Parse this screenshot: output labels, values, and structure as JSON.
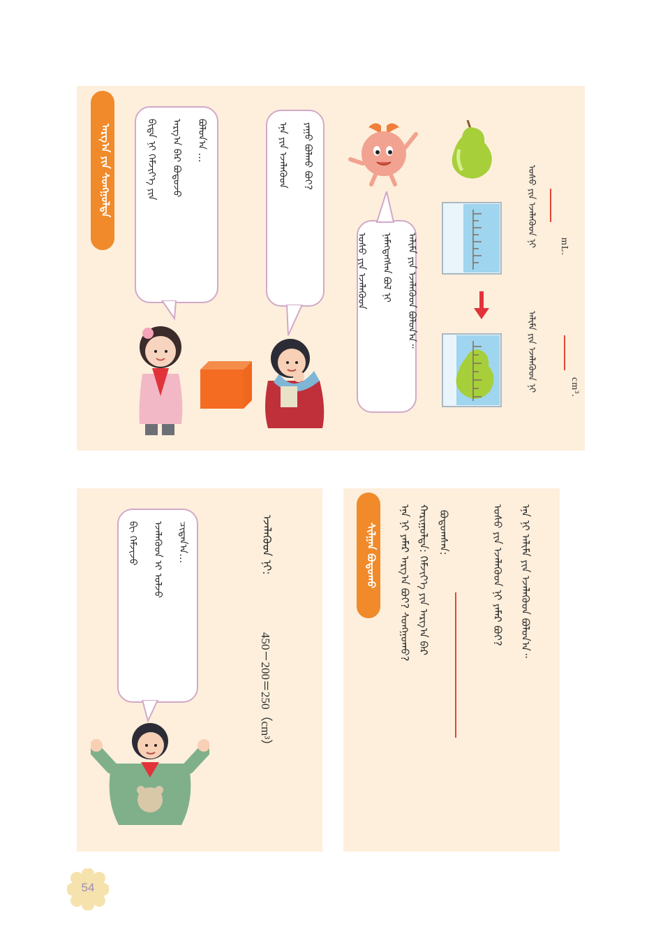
{
  "page": {
    "number": "54",
    "badge_color": "#f6e2ad"
  },
  "colors": {
    "panel": "#fdefdc",
    "tag": "#f08a2a",
    "bubble_border": "#d2a8c8",
    "rule": "#e2453a",
    "water": "#9fd5ef"
  },
  "left_panel": {
    "heading": "ᠠᠷᠭ᠎ᠠ ᠶᠢᠨ ᠰᠣᠩᠭᠣᠯᠲᠠ",
    "bubble_girl": [
      "ᠪᠢᠳᠡ ᠨᠢ ᠬᠡᠮᠵᠢᠶ᠎ᠡ ᠶᠢᠨ",
      "ᠠᠷᠭ᠎ᠠ ᠪᠡᠷ ᠪᠣᠳᠣᠵᠤ",
      "ᠪᠣᠯᠤᠨ᠎ᠠ …"
    ],
    "bubble_boy": [
      "ᠡᠨᠡ ᠶᠢᠨ ᠡᠵᠡᠯᠡᠬᠦᠦᠨ",
      "ᠶᠠᠭᠤ ᠪᠣᠯᠬᠤ ᠪᠣᠢ?"
    ],
    "bubble_fruit": [
      "ᠤᠰᠤ ᠶᠢᠨ ᠡᠵᠡᠯᠡᠬᠦᠦᠨ",
      "ᠨᠡᠮᠡᠭᠳᠡᠭᠰᠡᠨ ᠪᠣᠯ ᠨᠢ",
      "ᠠᠯᠢᠮᠠ ᠶᠢᠨ ᠡᠵᠡᠯᠡᠬᠦᠦᠨ ᠪᠣᠯᠤᠨ᠎ᠠ᠃"
    ],
    "unit_ml": "mL.",
    "unit_cm3": "cm³.",
    "line1": "ᠤᠰᠤ ᠶᠢᠨ ᠡᠵᠡᠯᠡᠬᠦᠦᠨ ᠨᠢ",
    "line2": "ᠠᠯᠢᠮᠠ ᠶᠢᠨ ᠡᠵᠡᠯᠡᠬᠦᠦᠨ ᠨᠢ"
  },
  "right_top": {
    "heading": "ᠰᠢᠯᠭᠠᠨ ᠪᠣᠳᠣᠬᠤ",
    "lines": [
      "ᠡᠨᠡ ᠨᠢ ᠶᠠᠮᠠᠷ ᠠᠷᠭ᠎ᠠ ᠪᠣᠢ? ᠰᠣᠩᠭᠣᠬᠤ?",
      "ᠬᠠᠷᠢᠭᠤᠯᠲᠠ: ᠬᠡᠮᠵᠢᠶ᠎ᠡ ᠶᠢᠨ ᠠᠷᠭ᠎ᠠ ᠪᠡᠷ",
      "ᠪᠣᠳᠣᠭᠰᠠᠨ:",
      "ᠤᠰᠤ ᠶᠢᠨ ᠡᠵᠡᠯᠡᠬᠦᠦᠨ ᠨᠢ ᠶᠠᠮᠠᠷ ᠪᠣᠢ?",
      "ᠡᠨᠡ ᠨᠢ ᠠᠯᠢᠮᠠ ᠶᠢᠨ ᠡᠵᠡᠯᠡᠬᠦᠦᠨ ᠪᠣᠯᠤᠨ᠎ᠠ᠃"
    ]
  },
  "right_bottom": {
    "equation_label": "ᠡᠵᠡᠯᠡᠬᠦᠦᠨ ᠨᠢ:",
    "equation": "450－200＝250（cm³）",
    "bubble": [
      "ᠪᠢ ᠬᠡᠮᠵᠢᠵᠦ",
      "ᠡᠵᠡᠯᠡᠬᠦᠦᠨ ᠢ ᠣᠯᠵᠤ",
      "ᠴᠢᠳᠠᠨ᠎ᠠ…"
    ]
  }
}
